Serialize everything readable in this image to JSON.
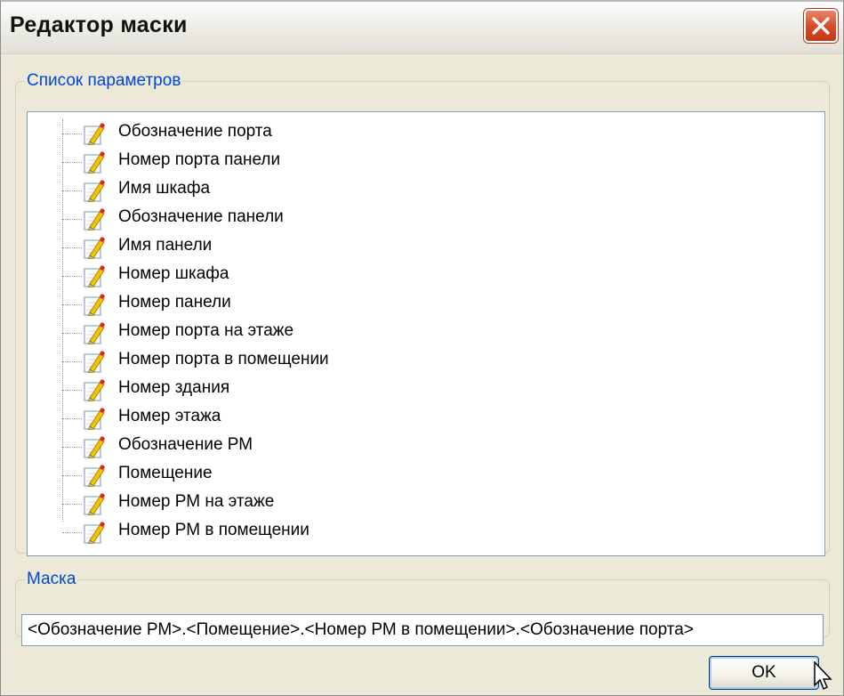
{
  "dialog": {
    "title": "Редактор маски",
    "close_icon": "close-x-icon"
  },
  "params": {
    "legend": "Список параметров",
    "item_icon": "pencil-edit-icon",
    "items": [
      "Обозначение порта",
      "Номер порта панели",
      "Имя шкафа",
      "Обозначение панели",
      "Имя панели",
      "Номер шкафа",
      "Номер панели",
      "Номер порта на этаже",
      "Номер порта в помещении",
      "Номер здания",
      "Номер этажа",
      "Обозначение РМ",
      "Помещение",
      "Номер РМ на этаже",
      "Номер РМ в помещении"
    ]
  },
  "mask": {
    "legend": "Маска",
    "value": "<Обозначение РМ>.<Помещение>.<Номер РМ в помещении>.<Обозначение порта>"
  },
  "buttons": {
    "ok_label": "OK"
  },
  "colors": {
    "legend_text": "#0046d5",
    "dialog_bg": "#ece9d8",
    "close_button": "#d44a24",
    "field_border": "#7f9db9"
  }
}
